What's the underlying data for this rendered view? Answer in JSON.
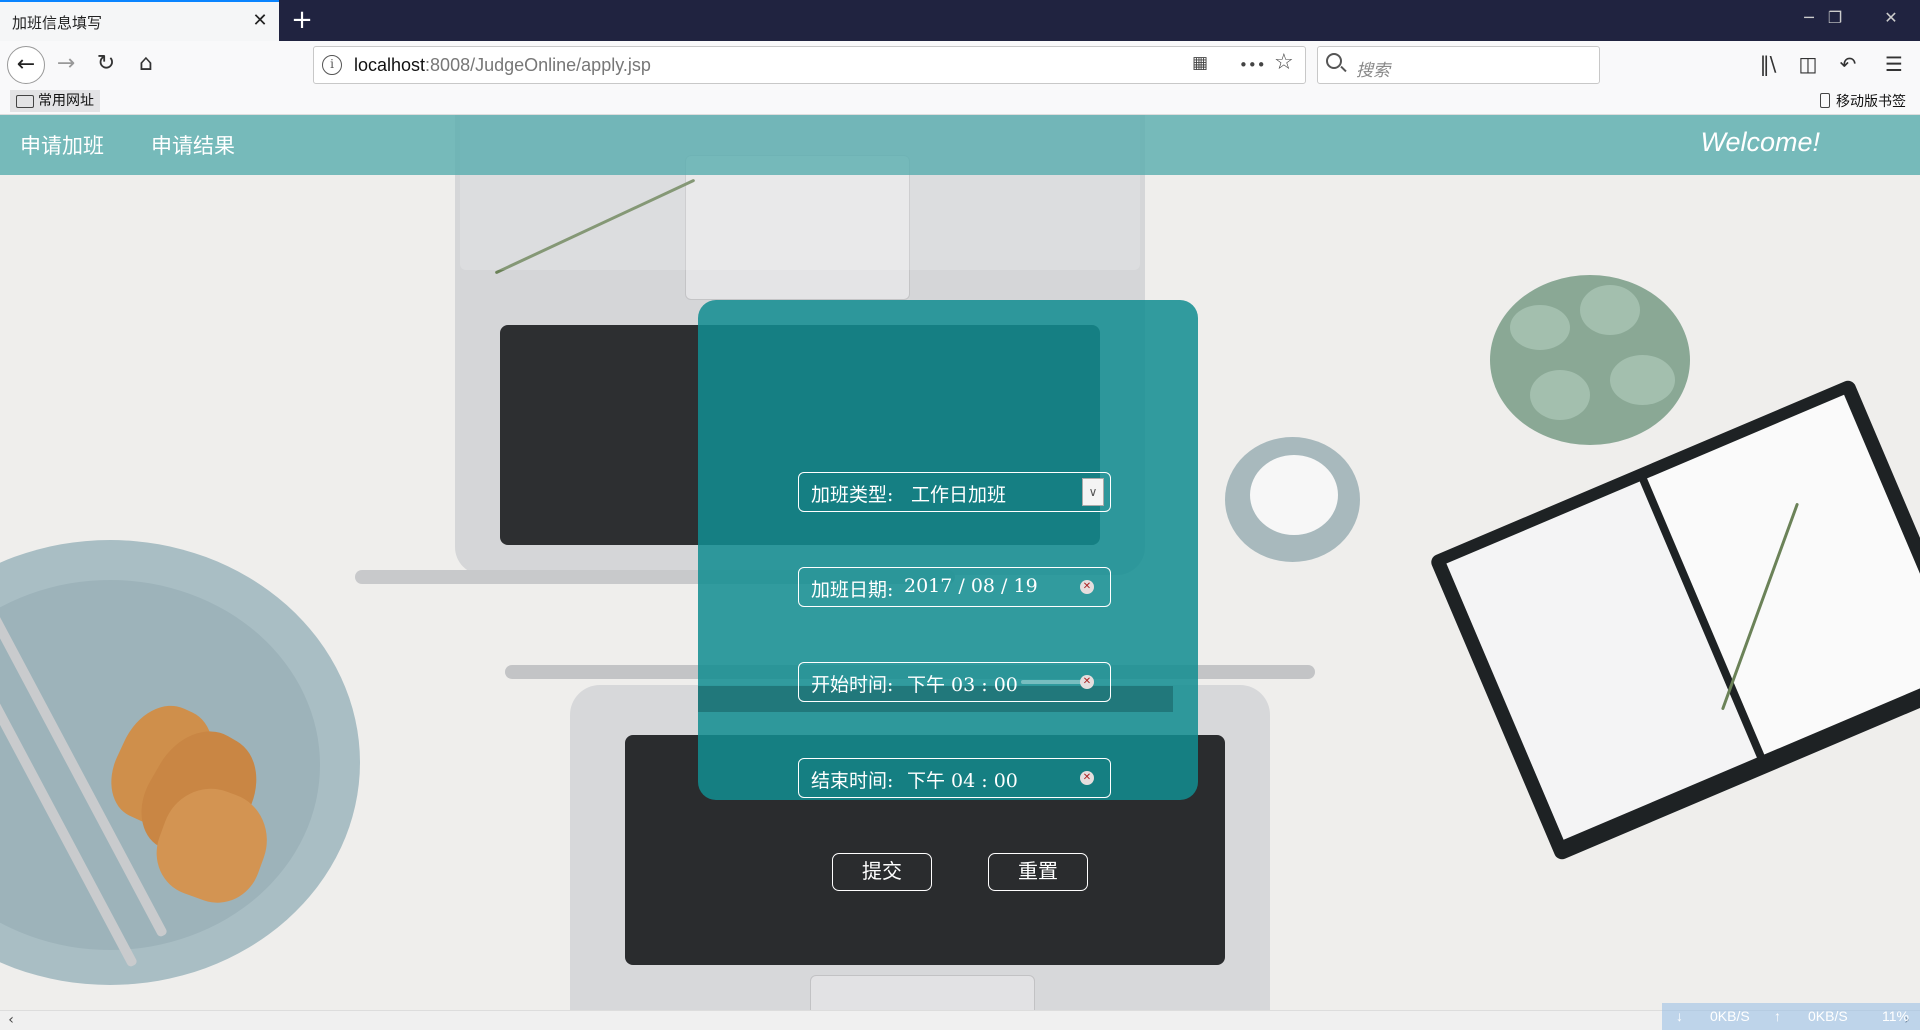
{
  "browser": {
    "tab_title": "加班信息填写",
    "tab_close": "✕",
    "new_tab": "+",
    "window_controls": {
      "minimize": "─",
      "restore": "❐",
      "close": "✕"
    },
    "url_host": "localhost",
    "url_rest": ":8008/JudgeOnline/apply.jsp",
    "url_info_icon": "i",
    "more_icon": "•••",
    "star_icon": "☆",
    "search_placeholder": "搜索",
    "bookmark_label": "常用网址",
    "mobile_bookmarks_label": "移动版书签",
    "icons": [
      "back-icon",
      "forward-icon",
      "reload-icon",
      "home-icon",
      "qr-icon",
      "library-icon",
      "sidebar-icon",
      "undo-icon",
      "menu-icon"
    ]
  },
  "header": {
    "nav": [
      "申请加班",
      "申请结果"
    ],
    "welcome": "Welcome!"
  },
  "form": {
    "type_label": "加班类型:",
    "type_value": "工作日加班",
    "date_label": "加班日期:",
    "date_value": "2017 / 08 / 19",
    "start_label": "开始时间:",
    "start_value": "下午  03 : 00",
    "end_label": "结束时间:",
    "end_value": "下午  04 : 00",
    "submit_label": "提交",
    "reset_label": "重置"
  },
  "status": {
    "down_speed": "0KB/S",
    "up_speed": "0KB/S",
    "extra": "11%"
  },
  "colors": {
    "header_bg": "#57acae",
    "panel_bg": "#118d90",
    "tabbar_bg": "#202340"
  }
}
